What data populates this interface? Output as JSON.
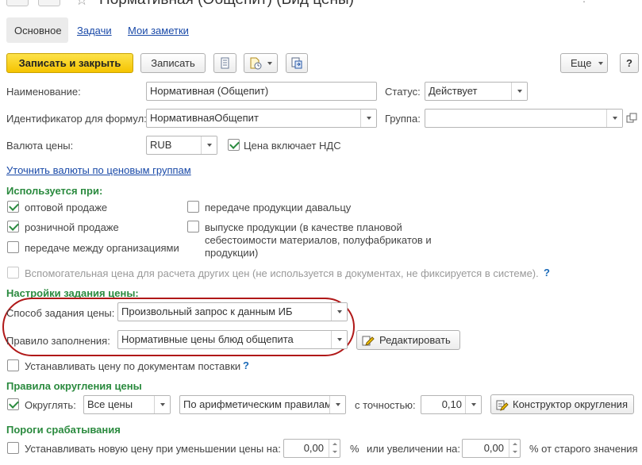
{
  "window": {
    "title": "Нормативная (Общепит) (Вид цены)"
  },
  "tabs": [
    {
      "label": "Основное"
    },
    {
      "label": "Задачи"
    },
    {
      "label": "Мои заметки"
    }
  ],
  "toolbar": {
    "save_close_label": "Записать и закрыть",
    "save_label": "Записать",
    "more_label": "Еще",
    "help_label": "?"
  },
  "form": {
    "name_label": "Наименование:",
    "name_value": "Нормативная (Общепит)",
    "status_label": "Статус:",
    "status_value": "Действует",
    "formula_id_label": "Идентификатор для формул:",
    "formula_id_value": "НормативнаяОбщепит",
    "group_label": "Группа:",
    "group_value": "",
    "currency_label": "Валюта цены:",
    "currency_value": "RUB",
    "vat_label": "Цена включает НДС",
    "refine_currency_link": "Уточнить валюты по ценовым группам"
  },
  "usage": {
    "header": "Используется при:",
    "wholesale": "оптовой продаже",
    "retail": "розничной продаже",
    "interorg": "передаче между организациями",
    "tolling": "передаче продукции давальцу",
    "production": "выпуске продукции (в качестве плановой",
    "production_line2": "себестоимости материалов, полуфабрикатов и",
    "production_line3": "продукции)",
    "auxiliary": "Вспомогательная цена для расчета других цен (не используется в документах, не фиксируется в системе).",
    "help": "?"
  },
  "price_settings": {
    "header": "Настройки задания цены:",
    "method_label": "Способ задания цены:",
    "method_value": "Произвольный запрос к данным ИБ",
    "rule_label": "Правило заполнения:",
    "rule_value": "Нормативные цены блюд общепита",
    "edit_button": "Редактировать",
    "set_by_docs": "Устанавливать цену по документам поставки",
    "help": "?"
  },
  "rounding": {
    "header": "Правила округления цены",
    "round_label": "Округлять:",
    "scope_value": "Все цены",
    "method_value": "По арифметическим правилам",
    "precision_label": "с точностью:",
    "precision_value": "0,10",
    "constructor_button": "Конструктор округления"
  },
  "thresholds": {
    "header": "Пороги срабатывания",
    "new_price_label": "Устанавливать новую цену при уменьшении цены на:",
    "decrease_value": "0,00",
    "percent_sign": "%",
    "increase_label": "или увеличении на:",
    "increase_value": "0,00",
    "old_value_label": "% от старого значения"
  },
  "colors": {
    "accent_green": "#2a8a3e",
    "link_blue": "#1a4aa8",
    "primary_yellow": "#f5c400",
    "annotation_red": "#b01818"
  }
}
